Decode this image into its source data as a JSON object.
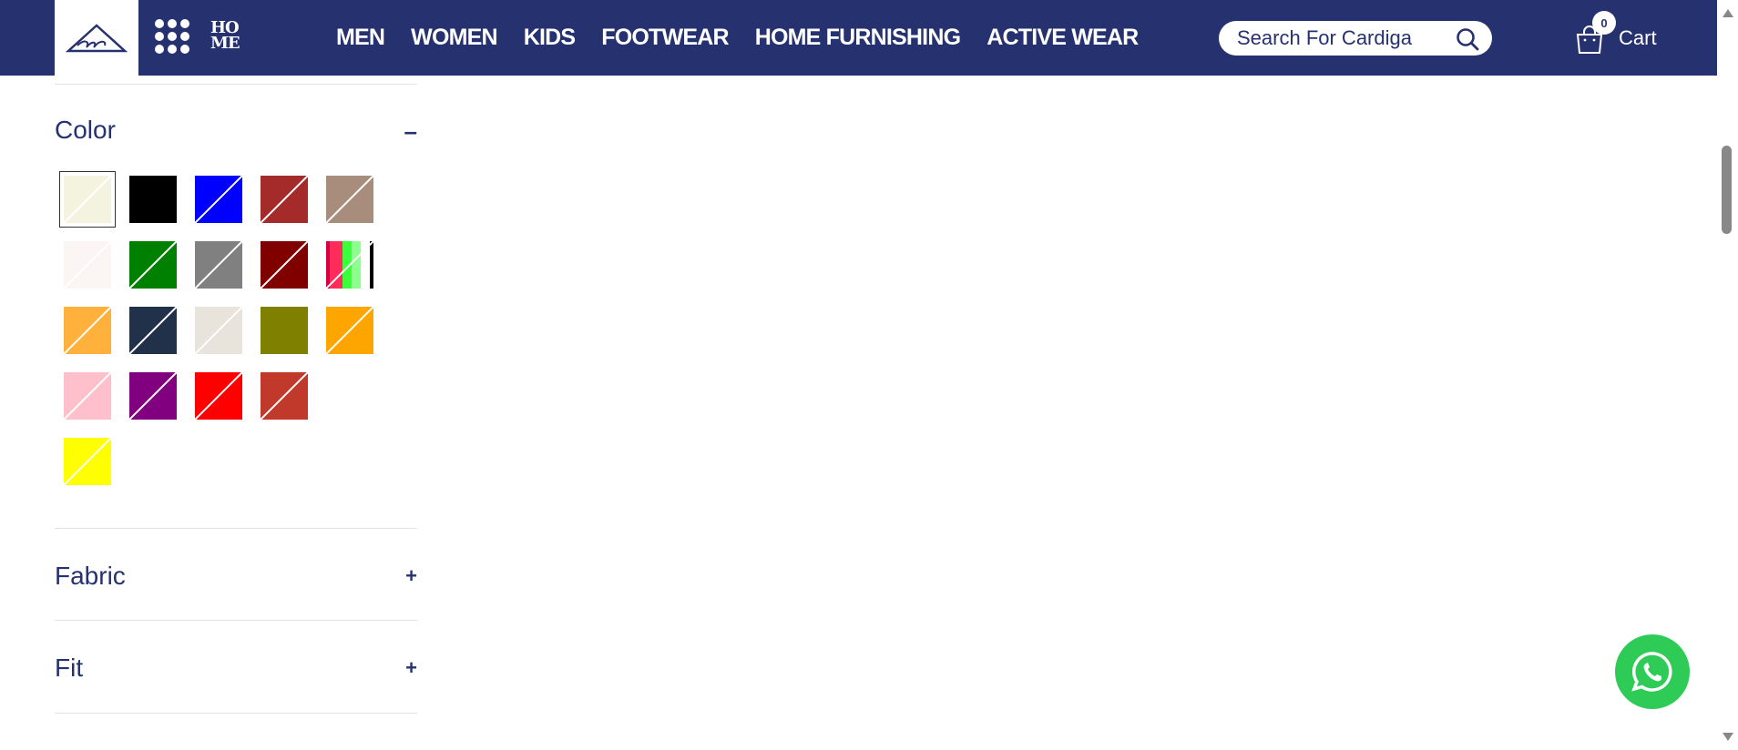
{
  "header": {
    "home_logo_top": "HO",
    "home_logo_bottom": "ME",
    "nav": [
      "MEN",
      "WOMEN",
      "KIDS",
      "FOOTWEAR",
      "HOME FURNISHING",
      "ACTIVE WEAR"
    ],
    "search_placeholder": "Search For Cardiga",
    "cart_count": "0",
    "cart_label": "Cart",
    "colors": {
      "background": "#263270",
      "text": "#ffffff"
    }
  },
  "filters": {
    "color": {
      "title": "Color",
      "toggle": "–",
      "swatches": [
        {
          "color": "#f3f3df",
          "selected": true
        },
        {
          "color": "#000000"
        },
        {
          "color": "#0000ff"
        },
        {
          "color": "#a52a2a"
        },
        {
          "color": "#a88d7c"
        },
        {
          "color": "#fbf5f3"
        },
        {
          "color": "#008000"
        },
        {
          "color": "#808080"
        },
        {
          "color": "#800000"
        },
        {
          "color": "multicolor"
        },
        {
          "color": "#ffb13b"
        },
        {
          "color": "#22314a"
        },
        {
          "color": "#e8e4dc"
        },
        {
          "color": "#808000"
        },
        {
          "color": "#ffa500"
        },
        {
          "color": "#ffc0cb"
        },
        {
          "color": "#800080"
        },
        {
          "color": "#ff0000"
        },
        {
          "color": "#c0392b"
        },
        {
          "color": "#ffffff"
        },
        {
          "color": "#ffff00"
        }
      ]
    },
    "fabric": {
      "title": "Fabric",
      "toggle": "+"
    },
    "fit": {
      "title": "Fit",
      "toggle": "+"
    }
  }
}
